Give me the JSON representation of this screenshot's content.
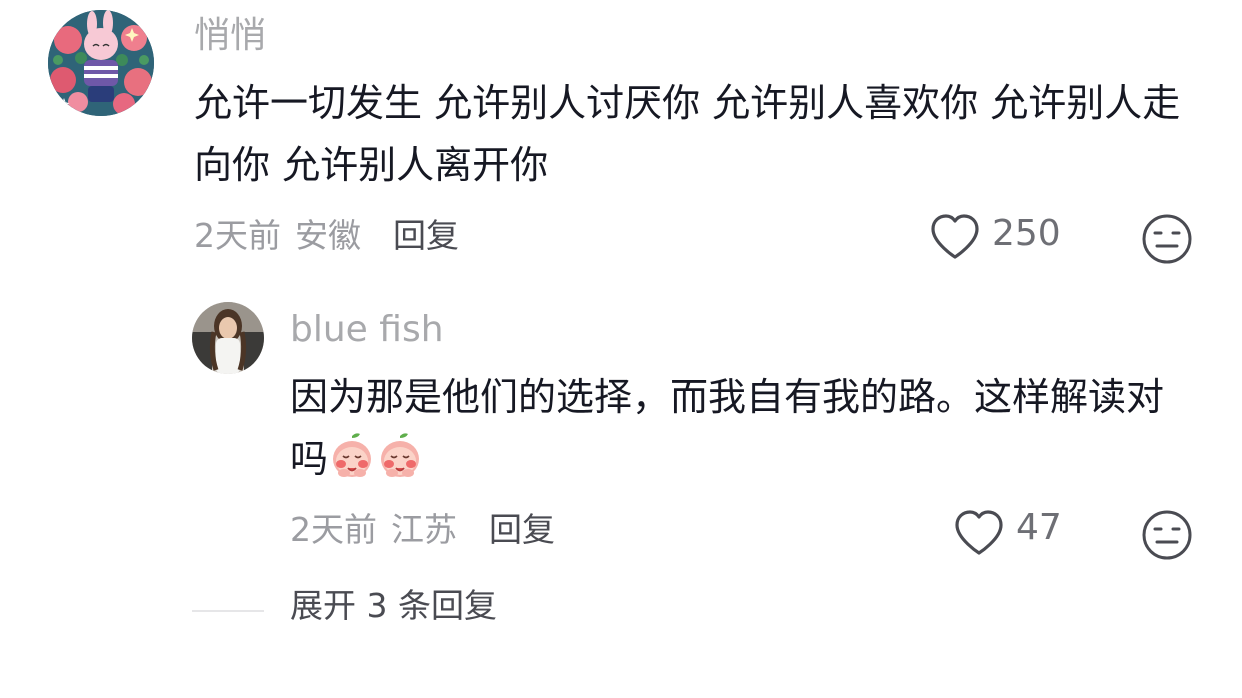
{
  "comment": {
    "username": "悄悄",
    "text": "允许一切发生 允许别人讨厌你 允许别人喜欢你 允许别人走向你 允许别人离开你",
    "time": "2天前",
    "location": "安徽",
    "reply_label": "回复",
    "like_count": "250",
    "avatar_icon": "pink-rabbit-avatar"
  },
  "reply": {
    "username": "blue fish",
    "text": "因为那是他们的选择，而我自有我的路。这样解读对吗",
    "emojis": [
      "blush-emoji",
      "blush-emoji"
    ],
    "time": "2天前",
    "location": "江苏",
    "reply_label": "回复",
    "like_count": "47",
    "avatar_icon": "girl-photo-avatar"
  },
  "expand_label": "展开 3 条回复",
  "icons": {
    "like": "heart-outline-icon",
    "dislike": "neutral-face-icon"
  },
  "colors": {
    "text_primary": "#161823",
    "text_secondary": "#9b9ca1",
    "username": "#a8a9ac",
    "icon": "#4a4b52"
  }
}
